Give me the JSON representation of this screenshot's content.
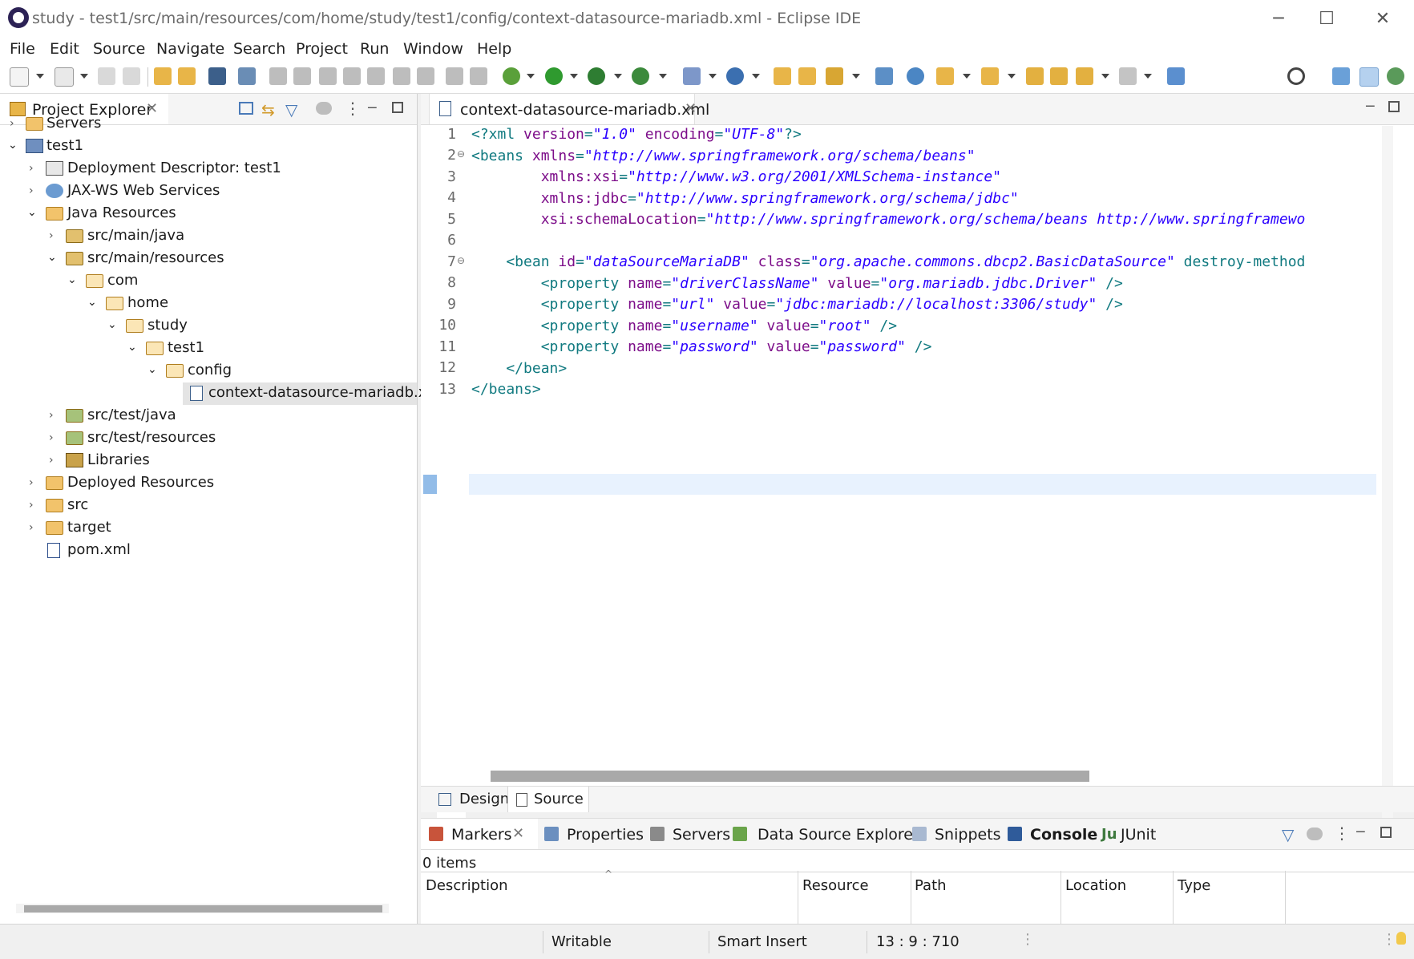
{
  "window": {
    "title": "study - test1/src/main/resources/com/home/study/test1/config/context-datasource-mariadb.xml - Eclipse IDE",
    "minimize_glyph": "─",
    "maximize_glyph": "☐",
    "close_glyph": "✕"
  },
  "menu": {
    "items": [
      "File",
      "Edit",
      "Source",
      "Navigate",
      "Search",
      "Project",
      "Run",
      "Window",
      "Help"
    ]
  },
  "project_explorer": {
    "tab_label": "Project Explorer",
    "tree": [
      {
        "label": "Servers"
      },
      {
        "label": "test1"
      },
      {
        "label": "Deployment Descriptor: test1"
      },
      {
        "label": "JAX-WS Web Services"
      },
      {
        "label": "Java Resources"
      },
      {
        "label": "src/main/java"
      },
      {
        "label": "src/main/resources"
      },
      {
        "label": "com"
      },
      {
        "label": "home"
      },
      {
        "label": "study"
      },
      {
        "label": "test1"
      },
      {
        "label": "config"
      },
      {
        "label": "context-datasource-mariadb.xn"
      },
      {
        "label": "src/test/java"
      },
      {
        "label": "src/test/resources"
      },
      {
        "label": "Libraries"
      },
      {
        "label": "Deployed Resources"
      },
      {
        "label": "src"
      },
      {
        "label": "target"
      },
      {
        "label": "pom.xml"
      }
    ]
  },
  "editor": {
    "tab_label": "context-datasource-mariadb.xml",
    "line_numbers": [
      "1",
      "2",
      "3",
      "4",
      "5",
      "6",
      "7",
      "8",
      "9",
      "10",
      "11",
      "12",
      "13"
    ],
    "lines": [
      {
        "pre": "<?xml ",
        "a1": "version",
        "e1": "=",
        "s1": "\"1.0\"",
        "a2": " encoding",
        "e2": "=",
        "s2": "\"UTF-8\"",
        "post": "?>"
      },
      {
        "pre": "<beans ",
        "a1": "xmlns",
        "e1": "=",
        "s1": "\"http://www.springframework.org/schema/beans\"",
        "a2": "",
        "e2": "",
        "s2": "",
        "post": ""
      },
      {
        "pre": "        ",
        "a1": "xmlns:xsi",
        "e1": "=",
        "s1": "\"http://www.w3.org/2001/XMLSchema-instance\"",
        "a2": "",
        "e2": "",
        "s2": "",
        "post": ""
      },
      {
        "pre": "        ",
        "a1": "xmlns:jdbc",
        "e1": "=",
        "s1": "\"http://www.springframework.org/schema/jdbc\"",
        "a2": "",
        "e2": "",
        "s2": "",
        "post": ""
      },
      {
        "pre": "        ",
        "a1": "xsi:schemaLocation",
        "e1": "=",
        "s1": "\"http://www.springframework.org/schema/beans http://www.springframewo",
        "a2": "",
        "e2": "",
        "s2": "",
        "post": ""
      },
      {
        "pre": "",
        "a1": "",
        "e1": "",
        "s1": "",
        "a2": "",
        "e2": "",
        "s2": "",
        "post": ""
      },
      {
        "pre": "    <bean ",
        "a1": "id",
        "e1": "=",
        "s1": "\"dataSourceMariaDB\"",
        "a2": " class",
        "e2": "=",
        "s2": "\"org.apache.commons.dbcp2.BasicDataSource\"",
        "post": " destroy-method"
      },
      {
        "pre": "        <property ",
        "a1": "name",
        "e1": "=",
        "s1": "\"driverClassName\"",
        "a2": " value",
        "e2": "=",
        "s2": "\"org.mariadb.jdbc.Driver\"",
        "post": " />"
      },
      {
        "pre": "        <property ",
        "a1": "name",
        "e1": "=",
        "s1": "\"url\"",
        "a2": " value",
        "e2": "=",
        "s2": "\"jdbc:mariadb://localhost:3306/study\"",
        "post": " />"
      },
      {
        "pre": "        <property ",
        "a1": "name",
        "e1": "=",
        "s1": "\"username\"",
        "a2": " value",
        "e2": "=",
        "s2": "\"root\"",
        "post": " />"
      },
      {
        "pre": "        <property ",
        "a1": "name",
        "e1": "=",
        "s1": "\"password\"",
        "a2": " value",
        "e2": "=",
        "s2": "\"password\"",
        "post": " />"
      },
      {
        "pre": "    </bean>",
        "a1": "",
        "e1": "",
        "s1": "",
        "a2": "",
        "e2": "",
        "s2": "",
        "post": ""
      },
      {
        "pre": "</beans>",
        "a1": "",
        "e1": "",
        "s1": "",
        "a2": "",
        "e2": "",
        "s2": "",
        "post": ""
      }
    ],
    "bottom_tabs": [
      "Design",
      "Source"
    ]
  },
  "bottom_panel": {
    "tabs": [
      "Markers",
      "Properties",
      "Servers",
      "Data Source Explorer",
      "Snippets",
      "Console",
      "JUnit"
    ],
    "item_count": "0 items",
    "columns": [
      "Description",
      "Resource",
      "Path",
      "Location",
      "Type"
    ]
  },
  "status_bar": {
    "writable": "Writable",
    "insert_mode": "Smart Insert",
    "position": "13 : 9 : 710"
  },
  "colors": {
    "tag": "#117a80",
    "attribute": "#7d0e8a",
    "string": "#2a00ff",
    "current_line": "#e8f2fe"
  },
  "icons": [
    "eclipse-icon",
    "search-icon",
    "filter-icon",
    "collapse-all-icon",
    "link-editor-icon",
    "view-menu-icon",
    "minimize-icon",
    "maximize-icon",
    "xml-file-icon",
    "folder-icon",
    "package-folder-icon",
    "run-icon",
    "debug-icon",
    "close-icon"
  ]
}
